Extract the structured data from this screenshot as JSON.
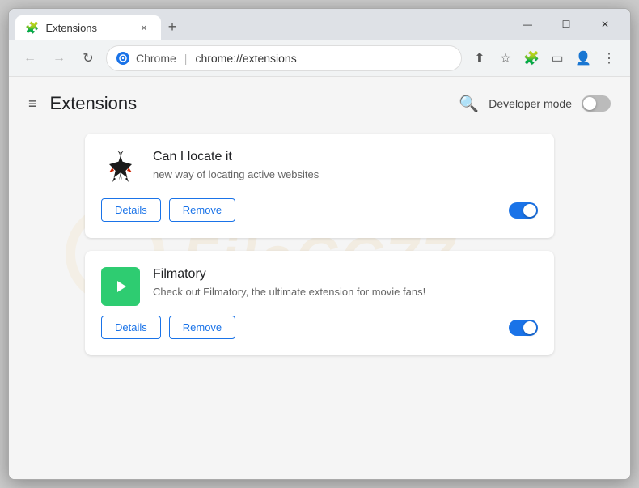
{
  "browser": {
    "tab_label": "Extensions",
    "tab_close": "×",
    "new_tab": "+",
    "window_controls": {
      "minimize": "—",
      "maximize": "☐",
      "close": "✕"
    },
    "nav": {
      "back": "←",
      "forward": "→",
      "reload": "↻"
    },
    "url": {
      "domain": "Chrome",
      "path": "chrome://extensions",
      "icon_letter": "C"
    },
    "toolbar": {
      "share": "⬆",
      "bookmark": "☆",
      "extensions": "🧩",
      "sidebar": "▭",
      "profile": "👤",
      "menu": "⋮"
    }
  },
  "extensions_page": {
    "title": "Extensions",
    "developer_mode_label": "Developer mode",
    "developer_mode_enabled": false,
    "extensions": [
      {
        "id": "can-i-locate-it",
        "name": "Can I locate it",
        "description": "new way of locating active websites",
        "enabled": true,
        "details_label": "Details",
        "remove_label": "Remove"
      },
      {
        "id": "filmatory",
        "name": "Filmatory",
        "description": "Check out Filmatory, the ultimate extension for movie fans!",
        "enabled": true,
        "details_label": "Details",
        "remove_label": "Remove"
      }
    ]
  },
  "icons": {
    "hamburger": "≡",
    "search": "🔍",
    "play": "▶"
  }
}
